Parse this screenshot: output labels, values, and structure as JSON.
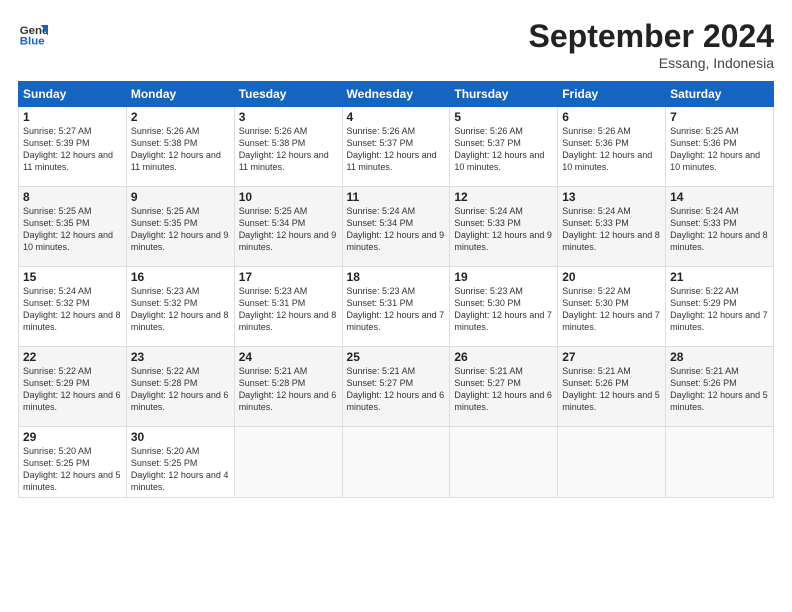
{
  "header": {
    "logo_general": "General",
    "logo_blue": "Blue",
    "month_title": "September 2024",
    "location": "Essang, Indonesia"
  },
  "weekdays": [
    "Sunday",
    "Monday",
    "Tuesday",
    "Wednesday",
    "Thursday",
    "Friday",
    "Saturday"
  ],
  "weeks": [
    [
      {
        "day": "1",
        "sunrise": "5:27 AM",
        "sunset": "5:39 PM",
        "daylight": "12 hours and 11 minutes."
      },
      {
        "day": "2",
        "sunrise": "5:26 AM",
        "sunset": "5:38 PM",
        "daylight": "12 hours and 11 minutes."
      },
      {
        "day": "3",
        "sunrise": "5:26 AM",
        "sunset": "5:38 PM",
        "daylight": "12 hours and 11 minutes."
      },
      {
        "day": "4",
        "sunrise": "5:26 AM",
        "sunset": "5:37 PM",
        "daylight": "12 hours and 11 minutes."
      },
      {
        "day": "5",
        "sunrise": "5:26 AM",
        "sunset": "5:37 PM",
        "daylight": "12 hours and 10 minutes."
      },
      {
        "day": "6",
        "sunrise": "5:26 AM",
        "sunset": "5:36 PM",
        "daylight": "12 hours and 10 minutes."
      },
      {
        "day": "7",
        "sunrise": "5:25 AM",
        "sunset": "5:36 PM",
        "daylight": "12 hours and 10 minutes."
      }
    ],
    [
      {
        "day": "8",
        "sunrise": "5:25 AM",
        "sunset": "5:35 PM",
        "daylight": "12 hours and 10 minutes."
      },
      {
        "day": "9",
        "sunrise": "5:25 AM",
        "sunset": "5:35 PM",
        "daylight": "12 hours and 9 minutes."
      },
      {
        "day": "10",
        "sunrise": "5:25 AM",
        "sunset": "5:34 PM",
        "daylight": "12 hours and 9 minutes."
      },
      {
        "day": "11",
        "sunrise": "5:24 AM",
        "sunset": "5:34 PM",
        "daylight": "12 hours and 9 minutes."
      },
      {
        "day": "12",
        "sunrise": "5:24 AM",
        "sunset": "5:33 PM",
        "daylight": "12 hours and 9 minutes."
      },
      {
        "day": "13",
        "sunrise": "5:24 AM",
        "sunset": "5:33 PM",
        "daylight": "12 hours and 8 minutes."
      },
      {
        "day": "14",
        "sunrise": "5:24 AM",
        "sunset": "5:33 PM",
        "daylight": "12 hours and 8 minutes."
      }
    ],
    [
      {
        "day": "15",
        "sunrise": "5:24 AM",
        "sunset": "5:32 PM",
        "daylight": "12 hours and 8 minutes."
      },
      {
        "day": "16",
        "sunrise": "5:23 AM",
        "sunset": "5:32 PM",
        "daylight": "12 hours and 8 minutes."
      },
      {
        "day": "17",
        "sunrise": "5:23 AM",
        "sunset": "5:31 PM",
        "daylight": "12 hours and 8 minutes."
      },
      {
        "day": "18",
        "sunrise": "5:23 AM",
        "sunset": "5:31 PM",
        "daylight": "12 hours and 7 minutes."
      },
      {
        "day": "19",
        "sunrise": "5:23 AM",
        "sunset": "5:30 PM",
        "daylight": "12 hours and 7 minutes."
      },
      {
        "day": "20",
        "sunrise": "5:22 AM",
        "sunset": "5:30 PM",
        "daylight": "12 hours and 7 minutes."
      },
      {
        "day": "21",
        "sunrise": "5:22 AM",
        "sunset": "5:29 PM",
        "daylight": "12 hours and 7 minutes."
      }
    ],
    [
      {
        "day": "22",
        "sunrise": "5:22 AM",
        "sunset": "5:29 PM",
        "daylight": "12 hours and 6 minutes."
      },
      {
        "day": "23",
        "sunrise": "5:22 AM",
        "sunset": "5:28 PM",
        "daylight": "12 hours and 6 minutes."
      },
      {
        "day": "24",
        "sunrise": "5:21 AM",
        "sunset": "5:28 PM",
        "daylight": "12 hours and 6 minutes."
      },
      {
        "day": "25",
        "sunrise": "5:21 AM",
        "sunset": "5:27 PM",
        "daylight": "12 hours and 6 minutes."
      },
      {
        "day": "26",
        "sunrise": "5:21 AM",
        "sunset": "5:27 PM",
        "daylight": "12 hours and 6 minutes."
      },
      {
        "day": "27",
        "sunrise": "5:21 AM",
        "sunset": "5:26 PM",
        "daylight": "12 hours and 5 minutes."
      },
      {
        "day": "28",
        "sunrise": "5:21 AM",
        "sunset": "5:26 PM",
        "daylight": "12 hours and 5 minutes."
      }
    ],
    [
      {
        "day": "29",
        "sunrise": "5:20 AM",
        "sunset": "5:25 PM",
        "daylight": "12 hours and 5 minutes."
      },
      {
        "day": "30",
        "sunrise": "5:20 AM",
        "sunset": "5:25 PM",
        "daylight": "12 hours and 4 minutes."
      },
      null,
      null,
      null,
      null,
      null
    ]
  ]
}
